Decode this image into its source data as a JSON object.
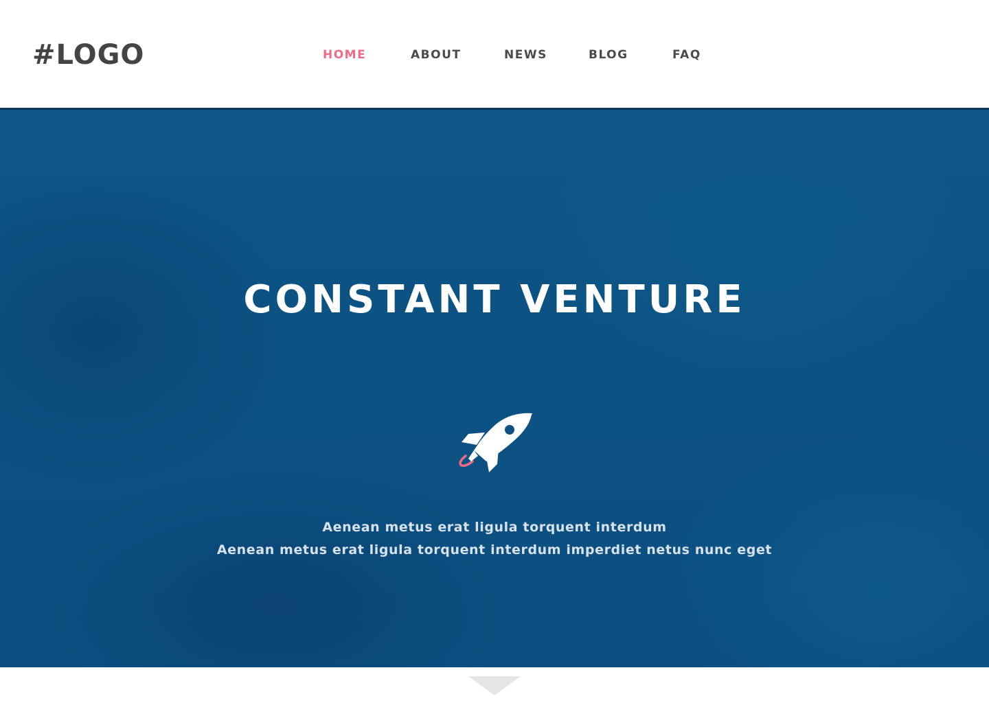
{
  "header": {
    "logo": "#LOGO",
    "nav": [
      {
        "label": "HOME",
        "active": true
      },
      {
        "label": "ABOUT",
        "active": false
      },
      {
        "label": "NEWS",
        "active": false
      },
      {
        "label": "BLOG",
        "active": false
      },
      {
        "label": "FAQ",
        "active": false
      }
    ]
  },
  "hero": {
    "title": "CONSTANT VENTURE",
    "icon": "rocket-icon",
    "line1": "Aenean metus erat ligula torquent interdum",
    "line2": "Aenean metus erat ligula torquent interdum imperdiet netus nunc eget"
  },
  "colors": {
    "accent": "#f06b85",
    "hero_blue": "#0c5283",
    "nav_text": "#4a4a4a",
    "logo_text": "#444444"
  },
  "scroll_indicator": {
    "icon": "down-triangle-icon"
  }
}
